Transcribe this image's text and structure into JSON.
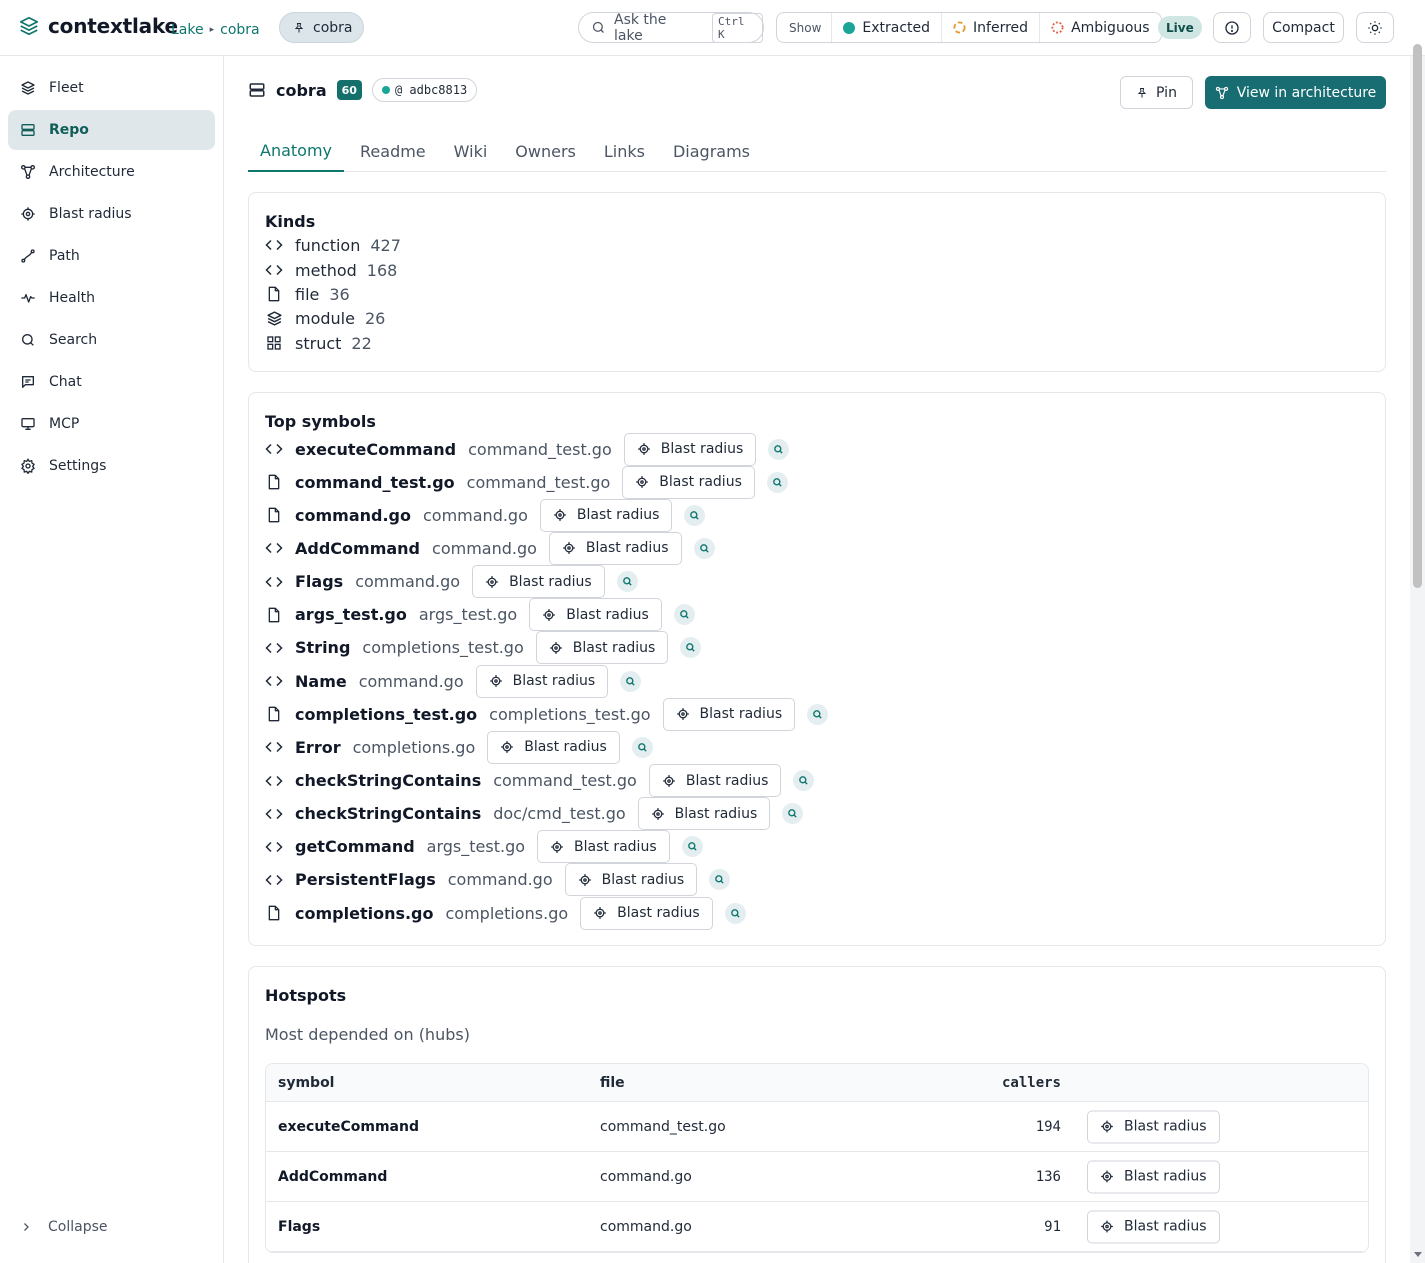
{
  "app": {
    "name": "contextlake",
    "breadcrumb": [
      "Lake",
      "cobra"
    ],
    "repo_pill": "cobra",
    "ask_placeholder": "Ask the lake",
    "ask_shortcut": "Ctrl K",
    "show_label": "Show",
    "filters": [
      {
        "label": "Extracted",
        "color": "#1aa597",
        "style": "solid"
      },
      {
        "label": "Inferred",
        "color": "#e59a2e",
        "style": "dashed"
      },
      {
        "label": "Ambiguous",
        "color": "#e05d3a",
        "style": "dotted"
      }
    ],
    "live_label": "Live",
    "compact_label": "Compact"
  },
  "sidebar": {
    "items": [
      {
        "label": "Fleet",
        "icon": "layers-icon",
        "active": false
      },
      {
        "label": "Repo",
        "icon": "server-icon",
        "active": true
      },
      {
        "label": "Architecture",
        "icon": "network-icon",
        "active": false
      },
      {
        "label": "Blast radius",
        "icon": "crosshair-icon",
        "active": false
      },
      {
        "label": "Path",
        "icon": "path-icon",
        "active": false
      },
      {
        "label": "Health",
        "icon": "pulse-icon",
        "active": false
      },
      {
        "label": "Search",
        "icon": "search-icon",
        "active": false
      },
      {
        "label": "Chat",
        "icon": "chat-icon",
        "active": false
      },
      {
        "label": "MCP",
        "icon": "monitor-icon",
        "active": false
      },
      {
        "label": "Settings",
        "icon": "gear-icon",
        "active": false
      }
    ],
    "collapse_label": "Collapse"
  },
  "repo": {
    "name": "cobra",
    "count": "60",
    "commit": "@ adbc8813",
    "pin_label": "Pin",
    "arch_label": "View in architecture"
  },
  "tabs": [
    "Anatomy",
    "Readme",
    "Wiki",
    "Owners",
    "Links",
    "Diagrams"
  ],
  "kinds": {
    "title": "Kinds",
    "items": [
      {
        "name": "function",
        "count": "427",
        "icon": "code-icon"
      },
      {
        "name": "method",
        "count": "168",
        "icon": "code-icon"
      },
      {
        "name": "file",
        "count": "36",
        "icon": "file-icon"
      },
      {
        "name": "module",
        "count": "26",
        "icon": "layers-icon"
      },
      {
        "name": "struct",
        "count": "22",
        "icon": "grid-icon"
      }
    ]
  },
  "top_symbols": {
    "title": "Top symbols",
    "blast_label": "Blast radius",
    "items": [
      {
        "name": "executeCommand",
        "file": "command_test.go",
        "icon": "code-icon"
      },
      {
        "name": "command_test.go",
        "file": "command_test.go",
        "icon": "file-icon"
      },
      {
        "name": "command.go",
        "file": "command.go",
        "icon": "file-icon"
      },
      {
        "name": "AddCommand",
        "file": "command.go",
        "icon": "code-icon"
      },
      {
        "name": "Flags",
        "file": "command.go",
        "icon": "code-icon"
      },
      {
        "name": "args_test.go",
        "file": "args_test.go",
        "icon": "file-icon"
      },
      {
        "name": "String",
        "file": "completions_test.go",
        "icon": "code-icon"
      },
      {
        "name": "Name",
        "file": "command.go",
        "icon": "code-icon"
      },
      {
        "name": "completions_test.go",
        "file": "completions_test.go",
        "icon": "file-icon"
      },
      {
        "name": "Error",
        "file": "completions.go",
        "icon": "code-icon"
      },
      {
        "name": "checkStringContains",
        "file": "command_test.go",
        "icon": "code-icon"
      },
      {
        "name": "checkStringContains",
        "file": "doc/cmd_test.go",
        "icon": "code-icon"
      },
      {
        "name": "getCommand",
        "file": "args_test.go",
        "icon": "code-icon"
      },
      {
        "name": "PersistentFlags",
        "file": "command.go",
        "icon": "code-icon"
      },
      {
        "name": "completions.go",
        "file": "completions.go",
        "icon": "file-icon"
      }
    ]
  },
  "hotspots": {
    "title": "Hotspots",
    "subtitle": "Most depended on (hubs)",
    "columns": [
      "symbol",
      "file",
      "callers"
    ],
    "blast_label": "Blast radius",
    "rows": [
      {
        "symbol": "executeCommand",
        "file": "command_test.go",
        "callers": "194"
      },
      {
        "symbol": "AddCommand",
        "file": "command.go",
        "callers": "136"
      },
      {
        "symbol": "Flags",
        "file": "command.go",
        "callers": "91"
      }
    ]
  },
  "colors": {
    "accent": "#0f766e",
    "primary_button": "#176d72",
    "active_nav_bg": "#dfe7eb"
  }
}
